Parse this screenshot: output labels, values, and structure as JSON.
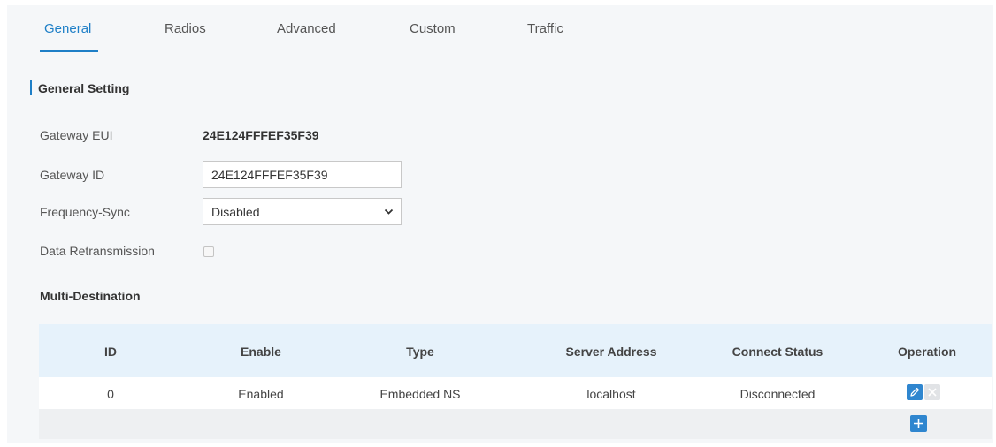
{
  "tabs": [
    {
      "label": "General",
      "active": true
    },
    {
      "label": "Radios",
      "active": false
    },
    {
      "label": "Advanced",
      "active": false
    },
    {
      "label": "Custom",
      "active": false
    },
    {
      "label": "Traffic",
      "active": false
    }
  ],
  "section": {
    "title": "General Setting"
  },
  "form": {
    "gateway_eui": {
      "label": "Gateway EUI",
      "value": "24E124FFFEF35F39"
    },
    "gateway_id": {
      "label": "Gateway ID",
      "value": "24E124FFFEF35F39"
    },
    "frequency_sync": {
      "label": "Frequency-Sync",
      "value": "Disabled"
    },
    "data_retransmission": {
      "label": "Data Retransmission",
      "checked": false
    }
  },
  "multi_destination": {
    "title": "Multi-Destination",
    "columns": [
      "ID",
      "Enable",
      "Type",
      "Server Address",
      "Connect Status",
      "Operation"
    ],
    "rows": [
      {
        "id": "0",
        "enable": "Enabled",
        "type": "Embedded NS",
        "server_address": "localhost",
        "connect_status": "Disconnected"
      }
    ]
  },
  "colors": {
    "accent": "#1e7fc7",
    "header_bg": "#e6f2fb",
    "page_bg": "#f5f7f9"
  },
  "icons": {
    "edit": "pencil-icon",
    "delete": "close-icon",
    "add": "plus-icon",
    "select": "chevron-down-icon"
  }
}
